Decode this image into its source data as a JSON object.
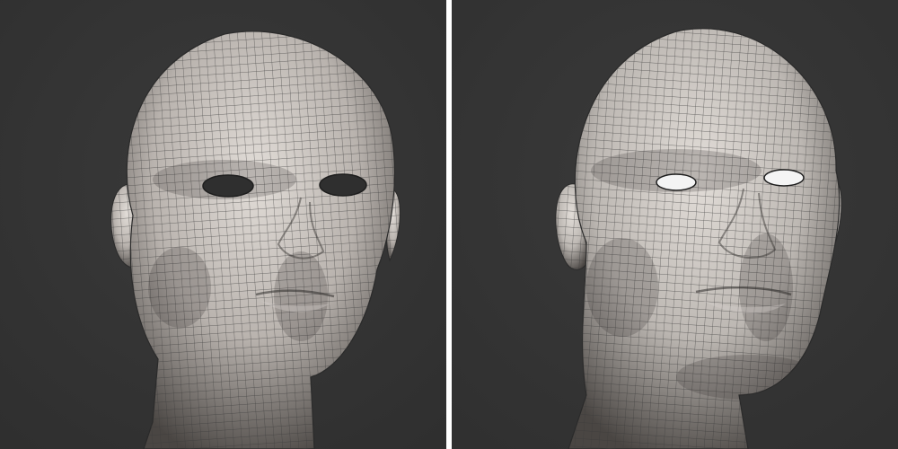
{
  "image": {
    "panels": [
      {
        "name": "female-head-wireframe",
        "eyes": "empty",
        "background": "#2f2f2f",
        "skin": "#b9b3ae",
        "wire": "#3a3a3a"
      },
      {
        "name": "male-head-wireframe",
        "eyes": "white",
        "background": "#303030",
        "skin": "#bdb8b3",
        "wire": "#3a3a3a"
      }
    ],
    "divider_color": "#ffffff"
  }
}
